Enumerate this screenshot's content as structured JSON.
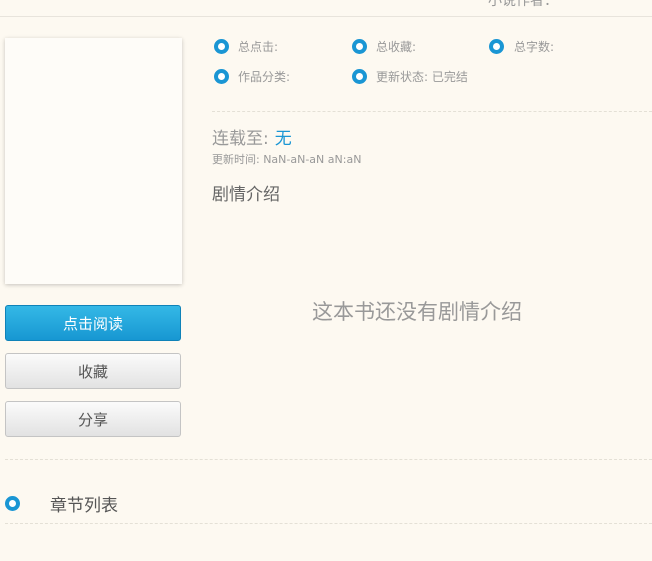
{
  "header": {
    "author_label": "小说作者："
  },
  "stats": {
    "total_clicks": "总点击:",
    "total_favorites": "总收藏:",
    "total_words": "总字数:",
    "category": "作品分类:",
    "status": "更新状态: 已完结"
  },
  "buttons": {
    "read": "点击阅读",
    "collect": "收藏",
    "share": "分享"
  },
  "update": {
    "label": "连载至:",
    "latest": "无",
    "time": "更新时间: NaN-aN-aN aN:aN"
  },
  "intro": {
    "title": "剧情介绍",
    "empty": "这本书还没有剧情介绍"
  },
  "chapters": {
    "title": "章节列表"
  },
  "colors": {
    "accent": "#1a96d4",
    "background": "#fdf9f1"
  }
}
